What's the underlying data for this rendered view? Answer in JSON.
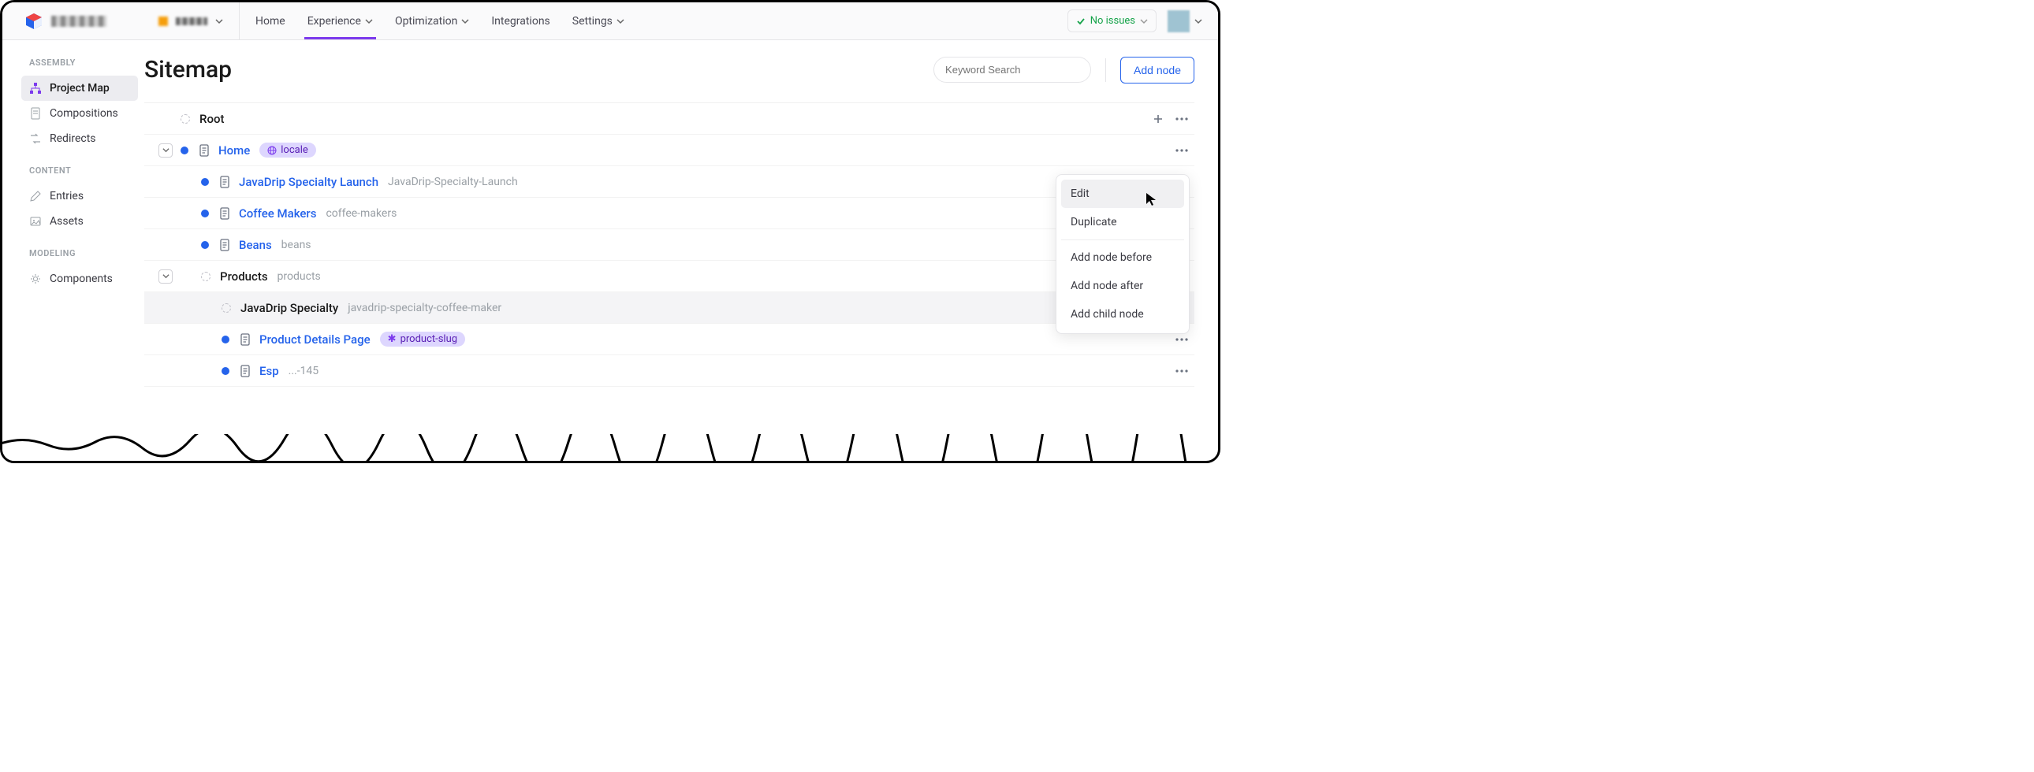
{
  "nav": {
    "home": "Home",
    "experience": "Experience",
    "optimization": "Optimization",
    "integrations": "Integrations",
    "settings": "Settings"
  },
  "issues": "No issues",
  "sidebar": {
    "assembly": "ASSEMBLY",
    "project_map": "Project Map",
    "compositions": "Compositions",
    "redirects": "Redirects",
    "content": "CONTENT",
    "entries": "Entries",
    "assets": "Assets",
    "modeling": "MODELING",
    "components": "Components"
  },
  "page": {
    "title": "Sitemap",
    "search_ph": "Keyword Search",
    "add_node": "Add node"
  },
  "tree": [
    {
      "name": "Root",
      "type": "empty",
      "slug": ""
    },
    {
      "name": "Home",
      "type": "linked-dot",
      "slug": "",
      "badge": "locale",
      "indent": 0,
      "exp": true
    },
    {
      "name": "JavaDrip Specialty Launch",
      "type": "link-dot",
      "slug": "JavaDrip-Specialty-Launch",
      "indent": 1
    },
    {
      "name": "Coffee Makers",
      "type": "link-dot",
      "slug": "coffee-makers",
      "indent": 1
    },
    {
      "name": "Beans",
      "type": "link-dot",
      "slug": "beans",
      "indent": 1
    },
    {
      "name": "Products",
      "type": "text-empty",
      "slug": "products",
      "indent": 1,
      "exp": true,
      "hover": false
    },
    {
      "name": "JavaDrip Specialty",
      "type": "text-empty",
      "slug": "javadrip-specialty-coffee-maker",
      "indent": 2,
      "hover": true
    },
    {
      "name": "Product Details Page",
      "type": "link-dot",
      "slug": "",
      "badge": "product-slug",
      "badge_star": true,
      "indent": 2
    },
    {
      "name": "Esp",
      "type": "link-dot",
      "slug": "...-145",
      "indent": 2,
      "cut": true
    }
  ],
  "ctx": {
    "edit": "Edit",
    "duplicate": "Duplicate",
    "before": "Add node before",
    "after": "Add node after",
    "child": "Add child node"
  }
}
